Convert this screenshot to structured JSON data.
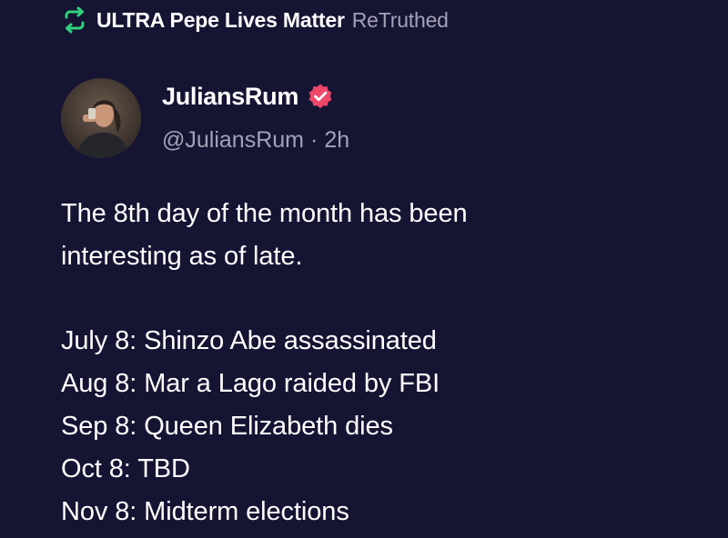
{
  "retruth": {
    "user": "ULTRA Pepe Lives Matter",
    "label": "ReTruthed",
    "icon": "retruth-icon",
    "icon_color": "#2fd17a"
  },
  "post": {
    "author": {
      "display_name": "JuliansRum",
      "handle": "@JuliansRum",
      "verified_icon": "verified-badge-icon",
      "verified_color": "#f0476b"
    },
    "separator": "·",
    "time": "2h",
    "intro_lines": [
      "The 8th day of the month has been",
      "interesting as of late."
    ],
    "list_lines": [
      "July 8: Shinzo Abe assassinated",
      "Aug 8: Mar a Lago raided by FBI",
      "Sep 8: Queen Elizabeth dies",
      "Oct 8: TBD",
      "Nov 8: Midterm elections"
    ]
  },
  "colors": {
    "background": "#161433",
    "text_primary": "#ffffff",
    "text_secondary": "#a3a1b6"
  }
}
